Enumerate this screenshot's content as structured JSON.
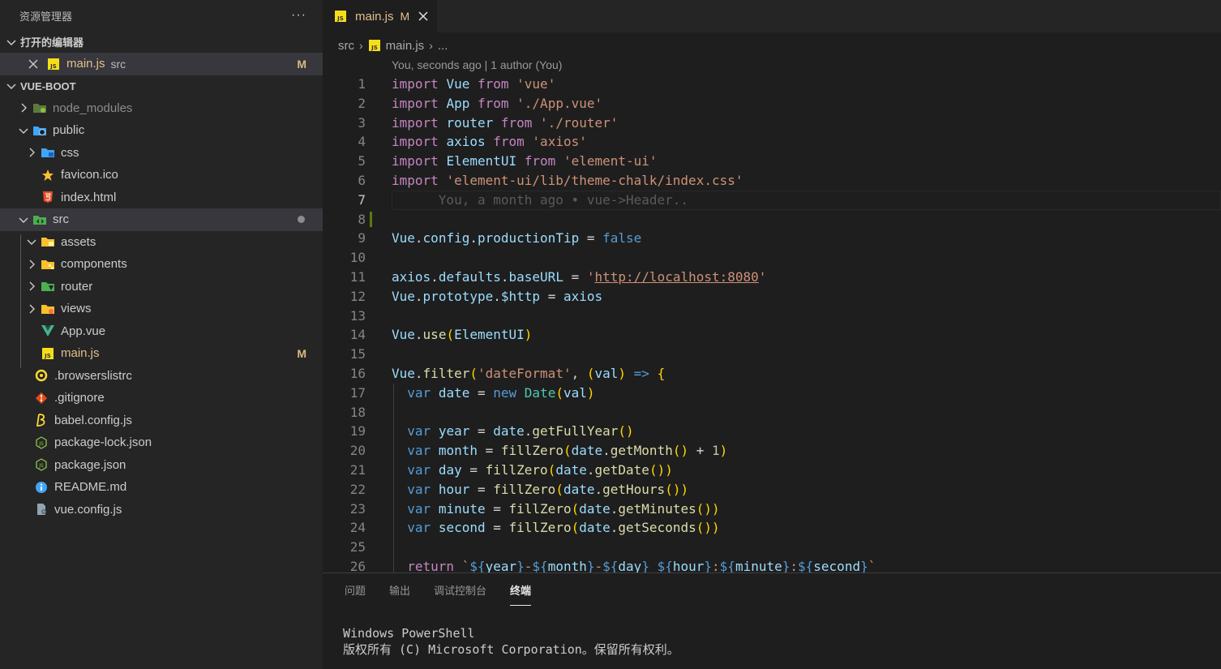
{
  "explorer": {
    "title": "资源管理器",
    "more": "···",
    "open_editors_label": "打开的编辑器",
    "open_editor": {
      "file": "main.js",
      "folder": "src",
      "badge": "M"
    },
    "project_label": "VUE-BOOT",
    "tree": [
      {
        "name": "node_modules",
        "type": "folder",
        "icon": "node-folder-icon",
        "expanded": false
      },
      {
        "name": "public",
        "type": "folder",
        "icon": "public-folder-icon",
        "expanded": true
      },
      {
        "name": "css",
        "type": "folder",
        "icon": "css-folder-icon",
        "expanded": false
      },
      {
        "name": "favicon.ico",
        "type": "file",
        "icon": "star-icon"
      },
      {
        "name": "index.html",
        "type": "file",
        "icon": "html5-icon"
      },
      {
        "name": "src",
        "type": "folder",
        "icon": "src-folder-icon",
        "expanded": true
      },
      {
        "name": "assets",
        "type": "folder",
        "icon": "assets-folder-icon",
        "expanded": true
      },
      {
        "name": "components",
        "type": "folder",
        "icon": "components-folder-icon",
        "expanded": false
      },
      {
        "name": "router",
        "type": "folder",
        "icon": "router-folder-icon",
        "expanded": false
      },
      {
        "name": "views",
        "type": "folder",
        "icon": "views-folder-icon",
        "expanded": false
      },
      {
        "name": "App.vue",
        "type": "file",
        "icon": "vue-icon"
      },
      {
        "name": "main.js",
        "type": "file",
        "icon": "js-icon",
        "badge": "M"
      },
      {
        "name": ".browserslistrc",
        "type": "file",
        "icon": "browserslist-icon"
      },
      {
        "name": ".gitignore",
        "type": "file",
        "icon": "git-icon"
      },
      {
        "name": "babel.config.js",
        "type": "file",
        "icon": "babel-icon"
      },
      {
        "name": "package-lock.json",
        "type": "file",
        "icon": "nodejs-icon"
      },
      {
        "name": "package.json",
        "type": "file",
        "icon": "nodejs-icon"
      },
      {
        "name": "README.md",
        "type": "file",
        "icon": "info-icon"
      },
      {
        "name": "vue.config.js",
        "type": "file",
        "icon": "config-file-icon"
      }
    ]
  },
  "editor": {
    "tab": {
      "label": "main.js",
      "badge": "M"
    },
    "breadcrumb": {
      "folder": "src",
      "file": "main.js",
      "more": "..."
    },
    "blame_header": "You, seconds ago | 1 author (You)",
    "inline_blame": "You, a month ago • vue->Header..",
    "code_lines": [
      "import Vue from 'vue'",
      "import App from './App.vue'",
      "import router from './router'",
      "import axios from 'axios'",
      "import ElementUI from 'element-ui'",
      "import 'element-ui/lib/theme-chalk/index.css'",
      "",
      "",
      "Vue.config.productionTip = false",
      "",
      "axios.defaults.baseURL = 'http://localhost:8080'",
      "Vue.prototype.$http = axios",
      "",
      "Vue.use(ElementUI)",
      "",
      "Vue.filter('dateFormat', (val) => {",
      "  var date = new Date(val)",
      "",
      "  var year = date.getFullYear()",
      "  var month = fillZero(date.getMonth() + 1)",
      "  var day = fillZero(date.getDate())",
      "  var hour = fillZero(date.getHours())",
      "  var minute = fillZero(date.getMinutes())",
      "  var second = fillZero(date.getSeconds())",
      "",
      "  return `${year}-${month}-${day} ${hour}:${minute}:${second}`"
    ],
    "line_numbers": [
      "1",
      "2",
      "3",
      "4",
      "5",
      "6",
      "7",
      "8",
      "9",
      "10",
      "11",
      "12",
      "13",
      "14",
      "15",
      "16",
      "17",
      "18",
      "19",
      "20",
      "21",
      "22",
      "23",
      "24",
      "25",
      "26"
    ]
  },
  "panel": {
    "tabs": [
      "问题",
      "输出",
      "调试控制台",
      "终端"
    ],
    "active_tab": "终端",
    "terminal_lines": [
      "Windows PowerShell",
      "版权所有 (C) Microsoft Corporation。保留所有权利。"
    ]
  },
  "colors": {
    "keyword": "#c586c0",
    "string": "#ce9178",
    "variable": "#9cdcfe",
    "function": "#dcdcaa",
    "modified": "#e2c08d"
  }
}
